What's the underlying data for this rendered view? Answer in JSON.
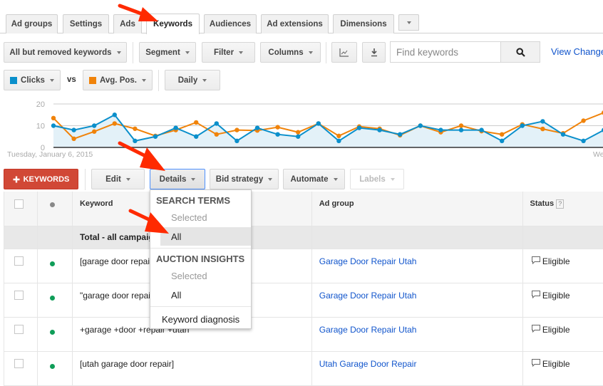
{
  "tabs": [
    {
      "label": "Ad groups",
      "active": false
    },
    {
      "label": "Settings",
      "active": false
    },
    {
      "label": "Ads",
      "active": false
    },
    {
      "label": "Keywords",
      "active": true
    },
    {
      "label": "Audiences",
      "active": false
    },
    {
      "label": "Ad extensions",
      "active": false
    },
    {
      "label": "Dimensions",
      "active": false
    }
  ],
  "toolbar": {
    "filter_scope": "All but removed keywords",
    "segment": "Segment",
    "filter": "Filter",
    "columns": "Columns",
    "search_placeholder": "Find keywords",
    "view_changes": "View Changes"
  },
  "chart_controls": {
    "metric1": "Clicks",
    "vs": "vs",
    "metric2": "Avg. Pos.",
    "granularity": "Daily"
  },
  "chart_data": {
    "type": "line",
    "title": "",
    "start_label": "Tuesday, January 6, 2015",
    "end_label": "We",
    "y_ticks": [
      "20",
      "10",
      "0"
    ],
    "ylim": [
      0,
      20
    ],
    "grid": true,
    "series": [
      {
        "name": "Clicks",
        "color": "#0a8fcb",
        "filled": true,
        "values": [
          10,
          8,
          10,
          15,
          3,
          5,
          9,
          5,
          11,
          3,
          9,
          6,
          5,
          11,
          3,
          9,
          8,
          6,
          10,
          8,
          8,
          8,
          3,
          10,
          12,
          6,
          3,
          8
        ]
      },
      {
        "name": "Avg. Pos.",
        "color": "#f0830a",
        "filled": false,
        "values": [
          13.5,
          4,
          7.3,
          11,
          8.6,
          5.3,
          8,
          11.5,
          6,
          8,
          7.8,
          9.3,
          7,
          11,
          5.3,
          9.6,
          8.6,
          5.6,
          10,
          7,
          10,
          7.5,
          6,
          10.6,
          8.5,
          6.5,
          12.3,
          16
        ]
      }
    ]
  },
  "actions": {
    "add_keywords": "KEYWORDS",
    "edit": "Edit",
    "details": "Details",
    "bid_strategy": "Bid strategy",
    "automate": "Automate",
    "labels": "Labels"
  },
  "details_menu": {
    "search_terms_header": "SEARCH TERMS",
    "search_terms_selected": "Selected",
    "search_terms_all": "All",
    "auction_insights_header": "AUCTION INSIGHTS",
    "auction_insights_selected": "Selected",
    "auction_insights_all": "All",
    "keyword_diagnosis": "Keyword diagnosis"
  },
  "table": {
    "headers": {
      "keyword": "Keyword",
      "ad_group": "Ad group",
      "status": "Status",
      "help": "?"
    },
    "total_label": "Total - all campaigns",
    "rows": [
      {
        "keyword": "[garage door repair utah]",
        "ad_group": "Garage Door Repair Utah",
        "status": "Eligible"
      },
      {
        "keyword": "\"garage door repair utah\"",
        "ad_group": "Garage Door Repair Utah",
        "status": "Eligible"
      },
      {
        "keyword": "+garage +door +repair +utah",
        "ad_group": "Garage Door Repair Utah",
        "status": "Eligible"
      },
      {
        "keyword": "[utah garage door repair]",
        "ad_group": "Utah Garage Door Repair",
        "status": "Eligible"
      }
    ]
  },
  "colors": {
    "clicks": "#0a8fcb",
    "avg_pos": "#f0830a",
    "primary_button": "#d14836",
    "link": "#1155cc",
    "enabled_dot": "#0f9d58",
    "annotation_arrow": "#ff2a00"
  }
}
